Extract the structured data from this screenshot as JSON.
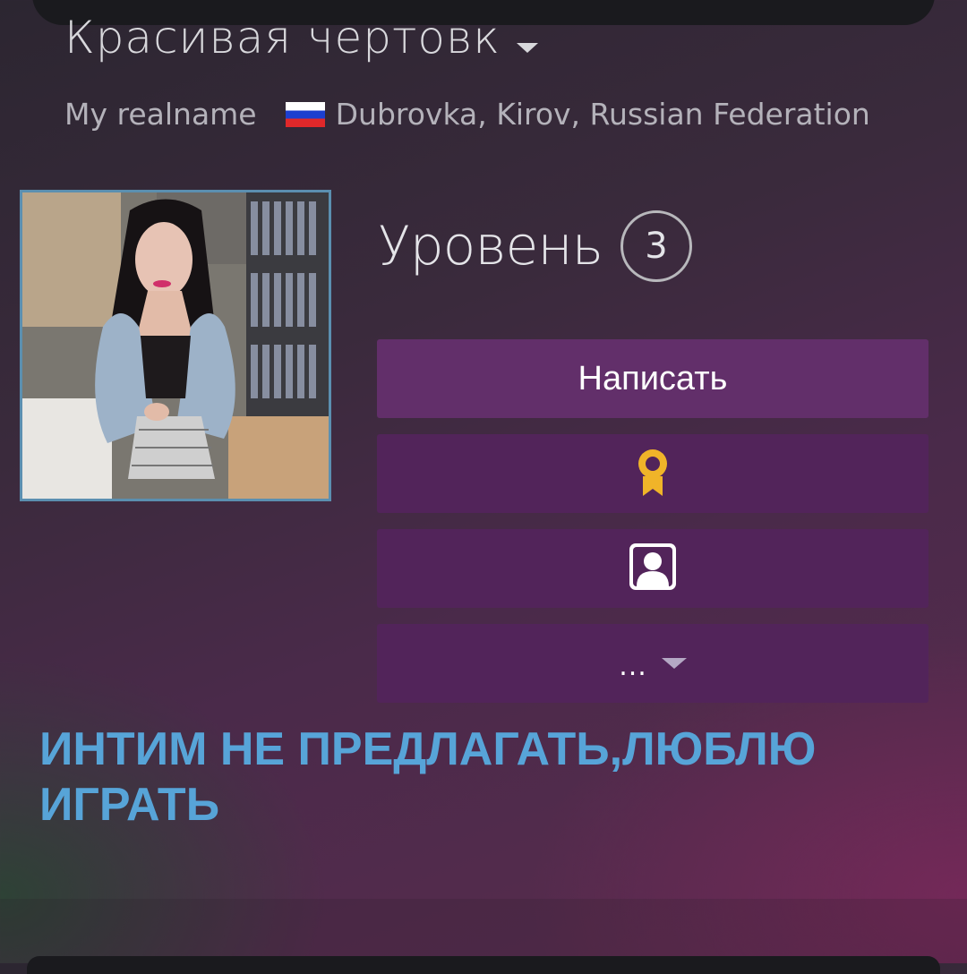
{
  "profile": {
    "persona_name": "Красивая чертовк",
    "real_name": "My realname",
    "location": "Dubrovka, Kirov, Russian Federation",
    "flag_icon": "russia-flag-icon"
  },
  "level": {
    "label": "Уровень",
    "value": "3"
  },
  "actions": {
    "message_label": "Написать",
    "award_icon": "award-ribbon-icon",
    "add_friend_icon": "add-friend-icon",
    "more_label": "..."
  },
  "summary": {
    "text": "ИНТИМ НЕ ПРЕДЛАГАТЬ,ЛЮБЛЮ ИГРАТЬ"
  },
  "colors": {
    "button_primary": "#622f6a",
    "button_secondary": "#52245a",
    "summary_text": "#57a4d8",
    "avatar_border": "#5b8fb0",
    "award_gold": "#f0b429"
  }
}
